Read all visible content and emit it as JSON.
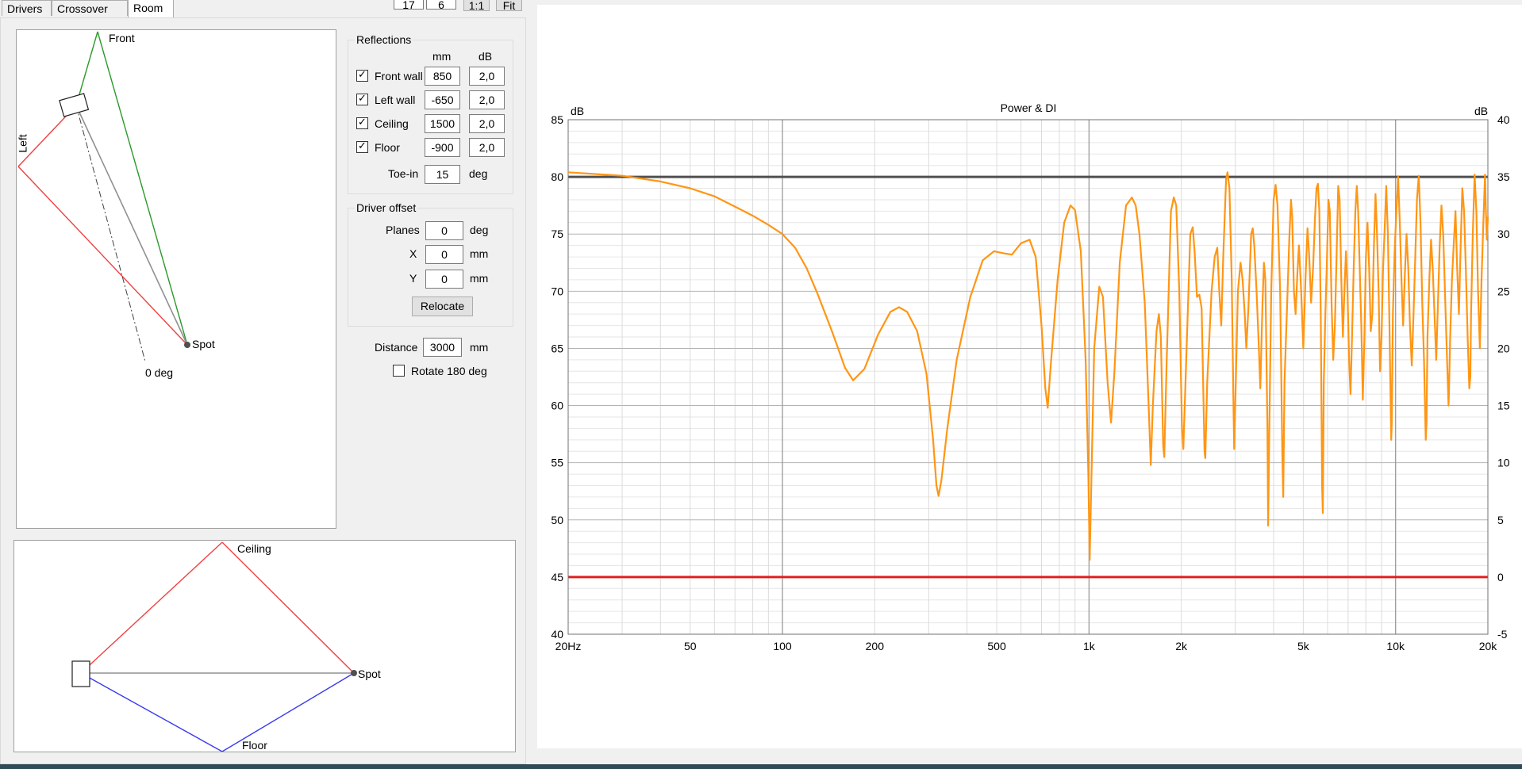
{
  "tabs": [
    {
      "label": "Drivers"
    },
    {
      "label": "Crossover"
    },
    {
      "label": "Room"
    }
  ],
  "toolbar": {
    "box1": "17",
    "box2": "6",
    "one_to_one": "1:1",
    "fit": "Fit"
  },
  "plan": {
    "front_label": "Front",
    "left_label": "Left",
    "spot_label": "Spot",
    "zero_deg_label": "0 deg"
  },
  "side": {
    "ceiling_label": "Ceiling",
    "floor_label": "Floor",
    "spot_label": "Spot"
  },
  "reflections": {
    "title": "Reflections",
    "col_mm": "mm",
    "col_db": "dB",
    "rows": [
      {
        "label": "Front wall",
        "checked": true,
        "mm": "850",
        "db": "2,0"
      },
      {
        "label": "Left wall",
        "checked": true,
        "mm": "-650",
        "db": "2,0"
      },
      {
        "label": "Ceiling",
        "checked": true,
        "mm": "1500",
        "db": "2,0"
      },
      {
        "label": "Floor",
        "checked": true,
        "mm": "-900",
        "db": "2,0"
      }
    ],
    "toe_in_label": "Toe-in",
    "toe_in_value": "15",
    "toe_in_unit": "deg"
  },
  "driver_offset": {
    "title": "Driver offset",
    "planes_label": "Planes",
    "planes_value": "0",
    "planes_unit": "deg",
    "x_label": "X",
    "x_value": "0",
    "x_unit": "mm",
    "y_label": "Y",
    "y_value": "0",
    "y_unit": "mm",
    "relocate_label": "Relocate"
  },
  "distance": {
    "label": "Distance",
    "value": "3000",
    "unit": "mm"
  },
  "rotate": {
    "label": "Rotate 180 deg",
    "checked": false
  },
  "chart_data": {
    "type": "line",
    "title": "Power & DI",
    "ylabel_left": "dB",
    "ylabel_right": "dB",
    "x_scale": "log",
    "xlim": [
      20,
      20000
    ],
    "ylim": [
      40,
      85
    ],
    "ylim_right": [
      -5,
      40
    ],
    "x_ticks": [
      {
        "v": 20,
        "label": "20Hz"
      },
      {
        "v": 50,
        "label": "50"
      },
      {
        "v": 100,
        "label": "100"
      },
      {
        "v": 200,
        "label": "200"
      },
      {
        "v": 500,
        "label": "500"
      },
      {
        "v": 1000,
        "label": "1k"
      },
      {
        "v": 2000,
        "label": "2k"
      },
      {
        "v": 5000,
        "label": "5k"
      },
      {
        "v": 10000,
        "label": "10k"
      },
      {
        "v": 20000,
        "label": "20k"
      }
    ],
    "y_ticks_left": [
      "85",
      "80",
      "75",
      "70",
      "65",
      "60",
      "55",
      "50",
      "45",
      "40"
    ],
    "y_ticks_right": [
      "40",
      "35",
      "30",
      "25",
      "20",
      "15",
      "10",
      "5",
      "0",
      "-5"
    ],
    "grid": true,
    "hlines": [
      {
        "name": "Power",
        "y": 80,
        "color": "#505050"
      },
      {
        "name": "DI",
        "y": 45,
        "color": "#e02020"
      }
    ],
    "series": [
      {
        "color": "#ff9614",
        "points": [
          [
            20,
            80.4
          ],
          [
            30,
            80.1
          ],
          [
            40,
            79.6
          ],
          [
            50,
            79.0
          ],
          [
            60,
            78.3
          ],
          [
            70,
            77.4
          ],
          [
            80,
            76.6
          ],
          [
            90,
            75.8
          ],
          [
            100,
            75.0
          ],
          [
            110,
            73.8
          ],
          [
            120,
            72.0
          ],
          [
            130,
            69.8
          ],
          [
            145,
            66.5
          ],
          [
            160,
            63.3
          ],
          [
            170,
            62.2
          ],
          [
            185,
            63.2
          ],
          [
            205,
            66.2
          ],
          [
            225,
            68.2
          ],
          [
            240,
            68.6
          ],
          [
            255,
            68.2
          ],
          [
            275,
            66.5
          ],
          [
            295,
            62.8
          ],
          [
            310,
            57.0
          ],
          [
            318,
            53.0
          ],
          [
            323,
            52.1
          ],
          [
            330,
            53.5
          ],
          [
            345,
            58.0
          ],
          [
            370,
            64.0
          ],
          [
            410,
            69.5
          ],
          [
            450,
            72.7
          ],
          [
            490,
            73.5
          ],
          [
            530,
            73.3
          ],
          [
            560,
            73.2
          ],
          [
            600,
            74.2
          ],
          [
            640,
            74.5
          ],
          [
            670,
            73.0
          ],
          [
            700,
            67.0
          ],
          [
            720,
            61.5
          ],
          [
            733,
            59.8
          ],
          [
            750,
            63.5
          ],
          [
            790,
            71.0
          ],
          [
            830,
            76.0
          ],
          [
            870,
            77.5
          ],
          [
            900,
            77.1
          ],
          [
            940,
            73.5
          ],
          [
            975,
            64.0
          ],
          [
            995,
            54.0
          ],
          [
            1005,
            46.5
          ],
          [
            1015,
            52.0
          ],
          [
            1040,
            65.0
          ],
          [
            1080,
            70.4
          ],
          [
            1110,
            69.5
          ],
          [
            1150,
            62.0
          ],
          [
            1180,
            58.5
          ],
          [
            1210,
            63.0
          ],
          [
            1260,
            72.5
          ],
          [
            1320,
            77.5
          ],
          [
            1380,
            78.2
          ],
          [
            1420,
            77.5
          ],
          [
            1460,
            75.0
          ],
          [
            1520,
            69.0
          ],
          [
            1565,
            60.0
          ],
          [
            1590,
            54.8
          ],
          [
            1615,
            60.0
          ],
          [
            1660,
            66.5
          ],
          [
            1690,
            68.0
          ],
          [
            1715,
            66.0
          ],
          [
            1745,
            56.5
          ],
          [
            1760,
            55.5
          ],
          [
            1790,
            63.5
          ],
          [
            1850,
            77.0
          ],
          [
            1890,
            78.2
          ],
          [
            1925,
            77.5
          ],
          [
            1970,
            70.0
          ],
          [
            2010,
            58.0
          ],
          [
            2030,
            56.2
          ],
          [
            2070,
            63.0
          ],
          [
            2140,
            75.0
          ],
          [
            2180,
            75.6
          ],
          [
            2210,
            73.5
          ],
          [
            2250,
            69.5
          ],
          [
            2290,
            69.7
          ],
          [
            2330,
            68.5
          ],
          [
            2380,
            56.0
          ],
          [
            2395,
            55.4
          ],
          [
            2430,
            62.0
          ],
          [
            2510,
            70.0
          ],
          [
            2570,
            73.0
          ],
          [
            2620,
            73.8
          ],
          [
            2660,
            70.0
          ],
          [
            2700,
            67.0
          ],
          [
            2740,
            73.0
          ],
          [
            2800,
            79.8
          ],
          [
            2830,
            80.4
          ],
          [
            2870,
            79.0
          ],
          [
            2920,
            71.0
          ],
          [
            2960,
            60.0
          ],
          [
            2975,
            56.2
          ],
          [
            3010,
            62.0
          ],
          [
            3060,
            70.0
          ],
          [
            3120,
            72.5
          ],
          [
            3170,
            71.0
          ],
          [
            3220,
            68.0
          ],
          [
            3260,
            65.0
          ],
          [
            3310,
            68.5
          ],
          [
            3380,
            75.0
          ],
          [
            3420,
            75.5
          ],
          [
            3460,
            74.0
          ],
          [
            3520,
            70.0
          ],
          [
            3580,
            65.0
          ],
          [
            3620,
            61.5
          ],
          [
            3680,
            69.0
          ],
          [
            3720,
            72.5
          ],
          [
            3760,
            71.0
          ],
          [
            3820,
            58.0
          ],
          [
            3840,
            49.5
          ],
          [
            3870,
            57.0
          ],
          [
            3930,
            70.0
          ],
          [
            4000,
            78.0
          ],
          [
            4060,
            79.3
          ],
          [
            4120,
            77.5
          ],
          [
            4200,
            70.0
          ],
          [
            4270,
            56.0
          ],
          [
            4300,
            52.0
          ],
          [
            4340,
            62.0
          ],
          [
            4430,
            69.0
          ],
          [
            4500,
            74.5
          ],
          [
            4560,
            78.0
          ],
          [
            4600,
            76.5
          ],
          [
            4660,
            70.0
          ],
          [
            4720,
            68.0
          ],
          [
            4780,
            71.5
          ],
          [
            4840,
            74.0
          ],
          [
            4920,
            70.0
          ],
          [
            5000,
            65.0
          ],
          [
            5080,
            71.0
          ],
          [
            5160,
            75.5
          ],
          [
            5230,
            73.0
          ],
          [
            5300,
            69.0
          ],
          [
            5380,
            72.0
          ],
          [
            5460,
            76.5
          ],
          [
            5520,
            79.0
          ],
          [
            5580,
            79.4
          ],
          [
            5640,
            77.0
          ],
          [
            5700,
            68.0
          ],
          [
            5760,
            53.0
          ],
          [
            5790,
            50.6
          ],
          [
            5830,
            62.0
          ],
          [
            5900,
            68.0
          ],
          [
            5960,
            72.0
          ],
          [
            6040,
            78.0
          ],
          [
            6100,
            77.0
          ],
          [
            6180,
            69.0
          ],
          [
            6260,
            64.0
          ],
          [
            6340,
            67.0
          ],
          [
            6420,
            73.0
          ],
          [
            6500,
            79.2
          ],
          [
            6570,
            78.0
          ],
          [
            6650,
            71.0
          ],
          [
            6730,
            66.0
          ],
          [
            6810,
            70.0
          ],
          [
            6890,
            73.5
          ],
          [
            6970,
            70.0
          ],
          [
            7050,
            64.0
          ],
          [
            7130,
            61.0
          ],
          [
            7210,
            66.0
          ],
          [
            7300,
            72.0
          ],
          [
            7390,
            77.0
          ],
          [
            7470,
            79.2
          ],
          [
            7550,
            77.0
          ],
          [
            7640,
            72.0
          ],
          [
            7730,
            67.0
          ],
          [
            7820,
            60.5
          ],
          [
            7910,
            66.0
          ],
          [
            8000,
            73.0
          ],
          [
            8100,
            76.0
          ],
          [
            8200,
            72.0
          ],
          [
            8300,
            66.5
          ],
          [
            8400,
            68.0
          ],
          [
            8500,
            74.0
          ],
          [
            8600,
            78.5
          ],
          [
            8700,
            75.0
          ],
          [
            8800,
            70.0
          ],
          [
            8900,
            63.0
          ],
          [
            9000,
            66.0
          ],
          [
            9100,
            72.0
          ],
          [
            9200,
            75.0
          ],
          [
            9320,
            79.2
          ],
          [
            9440,
            75.0
          ],
          [
            9560,
            66.0
          ],
          [
            9680,
            57.0
          ],
          [
            9720,
            58.5
          ],
          [
            9800,
            68.0
          ],
          [
            9930,
            73.5
          ],
          [
            10060,
            77.0
          ],
          [
            10190,
            80.0
          ],
          [
            10320,
            76.0
          ],
          [
            10450,
            71.0
          ],
          [
            10580,
            67.0
          ],
          [
            10720,
            71.5
          ],
          [
            10860,
            75.0
          ],
          [
            11000,
            72.0
          ],
          [
            11140,
            67.0
          ],
          [
            11290,
            63.5
          ],
          [
            11440,
            68.0
          ],
          [
            11590,
            73.0
          ],
          [
            11740,
            78.0
          ],
          [
            11900,
            80.1
          ],
          [
            12060,
            76.0
          ],
          [
            12220,
            69.0
          ],
          [
            12380,
            64.0
          ],
          [
            12540,
            57.0
          ],
          [
            12620,
            58.5
          ],
          [
            12710,
            66.0
          ],
          [
            12880,
            71.0
          ],
          [
            13050,
            74.5
          ],
          [
            13220,
            72.0
          ],
          [
            13390,
            68.0
          ],
          [
            13570,
            64.0
          ],
          [
            13750,
            69.0
          ],
          [
            13930,
            74.0
          ],
          [
            14110,
            77.5
          ],
          [
            14300,
            75.0
          ],
          [
            14490,
            70.0
          ],
          [
            14680,
            65.0
          ],
          [
            14880,
            60.0
          ],
          [
            14930,
            61.0
          ],
          [
            15070,
            66.0
          ],
          [
            15270,
            71.0
          ],
          [
            15470,
            74.0
          ],
          [
            15680,
            77.0
          ],
          [
            15880,
            72.0
          ],
          [
            16090,
            68.0
          ],
          [
            16300,
            74.0
          ],
          [
            16510,
            79.0
          ],
          [
            16730,
            77.0
          ],
          [
            16950,
            72.0
          ],
          [
            17180,
            66.0
          ],
          [
            17400,
            61.5
          ],
          [
            17530,
            62.5
          ],
          [
            17630,
            68.0
          ],
          [
            17860,
            75.0
          ],
          [
            18100,
            80.2
          ],
          [
            18340,
            77.0
          ],
          [
            18580,
            70.0
          ],
          [
            18830,
            65.0
          ],
          [
            19070,
            71.0
          ],
          [
            19330,
            76.0
          ],
          [
            19580,
            80.2
          ],
          [
            19710,
            77.0
          ],
          [
            19840,
            74.5
          ],
          [
            20000,
            76.5
          ]
        ]
      }
    ]
  }
}
